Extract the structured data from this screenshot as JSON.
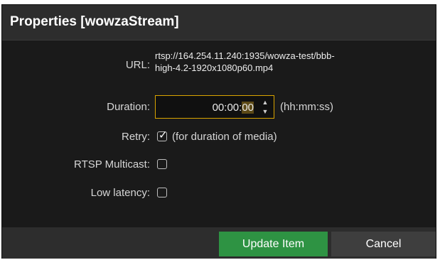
{
  "dialog": {
    "title": "Properties [wowzaStream]"
  },
  "fields": {
    "url": {
      "label": "URL:",
      "value_line1": "rtsp://164.254.11.240:1935/wowza-test/bbb-",
      "value_line2": "high-4.2-1920x1080p60.mp4"
    },
    "duration": {
      "label": "Duration:",
      "value_prefix": "00:00:",
      "value_selected": "00",
      "hint": "(hh:mm:ss)",
      "spin_up_icon": "chevron-up",
      "spin_down_icon": "chevron-down"
    },
    "retry": {
      "label": "Retry:",
      "checked": true,
      "hint": "(for duration of media)"
    },
    "rtsp_multicast": {
      "label": "RTSP Multicast:",
      "checked": false
    },
    "low_latency": {
      "label": "Low latency:",
      "checked": false
    }
  },
  "buttons": {
    "update": "Update Item",
    "cancel": "Cancel"
  },
  "colors": {
    "dialog_bg": "#1a1a1a",
    "titlebar_bg": "#2d2d2d",
    "accent_focus": "#d9a300",
    "update_button": "#2e9343",
    "cancel_button": "#3e3e3e"
  }
}
